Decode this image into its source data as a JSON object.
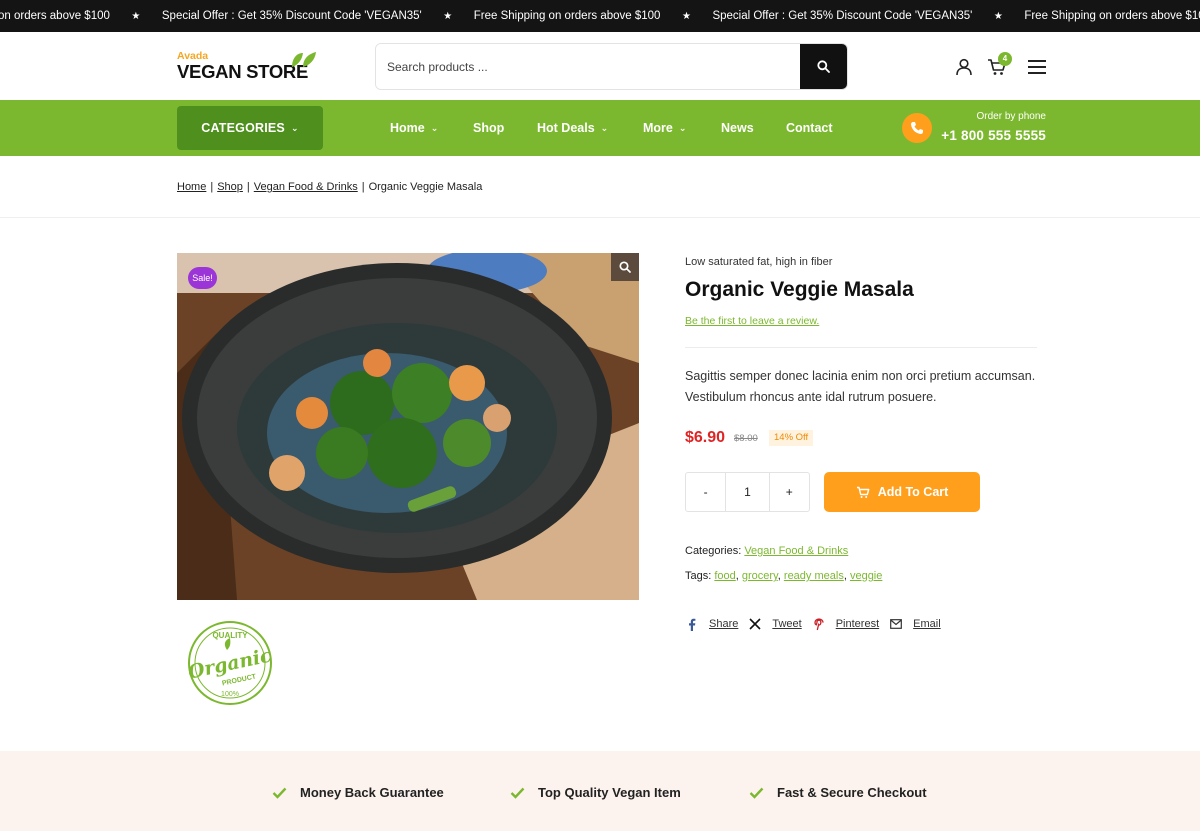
{
  "topbar": {
    "items": [
      "on orders above $100",
      "Special Offer : Get 35% Discount Code 'VEGAN35'",
      "Free Shipping on orders above $100",
      "Special Offer : Get 35% Discount Code 'VEGAN35'",
      "Free Shipping on orders above $100"
    ],
    "separator": "★"
  },
  "header": {
    "logo_small": "Avada",
    "logo_big": "VEGAN STORE",
    "search_placeholder": "Search products ...",
    "cart_count": "4"
  },
  "nav": {
    "categories_label": "CATEGORIES",
    "items": [
      "Home",
      "Shop",
      "Hot Deals",
      "More",
      "News",
      "Contact"
    ],
    "order_label": "Order by phone",
    "phone": "+1 800 555 5555"
  },
  "breadcrumb": {
    "items": [
      "Home",
      "Shop",
      "Vegan Food & Drinks"
    ],
    "current": "Organic Veggie Masala",
    "separator": "|"
  },
  "product": {
    "sale_badge": "Sale!",
    "subtitle": "Low saturated fat, high in fiber",
    "title": "Organic Veggie Masala",
    "review_link": "Be the first to leave a review.",
    "description": "Sagittis semper donec lacinia enim non orci pretium accumsan. Vestibulum rhoncus ante idal rutrum posuere.",
    "price": "$6.90",
    "old_price": "$8.00",
    "discount": "14% Off",
    "quantity": "1",
    "minus": "-",
    "plus": "+",
    "add_to_cart": "Add To Cart",
    "categories_label": "Categories:",
    "categories": [
      "Vegan Food & Drinks"
    ],
    "tags_label": "Tags:",
    "tags": [
      "food",
      "grocery",
      "ready meals",
      "veggie"
    ],
    "share": [
      "Share",
      "Tweet",
      "Pinterest",
      "Email"
    ]
  },
  "stamp": {
    "top": "QUALITY",
    "main": "Organic",
    "sub": "PRODUCT",
    "bottom": "100%"
  },
  "features": [
    "Money Back Guarantee",
    "Top Quality Vegan Item",
    "Fast & Secure Checkout"
  ],
  "colors": {
    "green": "#7cb82f",
    "dark_green": "#4f8f1d",
    "orange": "#ff9f1c",
    "sale_purple": "#9b35d8",
    "price_red": "#e02424",
    "topbar": "#141414",
    "band": "#fcf3ee"
  },
  "icons": [
    "search-icon",
    "user-icon",
    "cart-icon",
    "menu-icon",
    "phone-icon",
    "zoom-icon",
    "facebook-icon",
    "x-icon",
    "pinterest-icon",
    "email-icon",
    "check-icon",
    "leaf-icon"
  ]
}
